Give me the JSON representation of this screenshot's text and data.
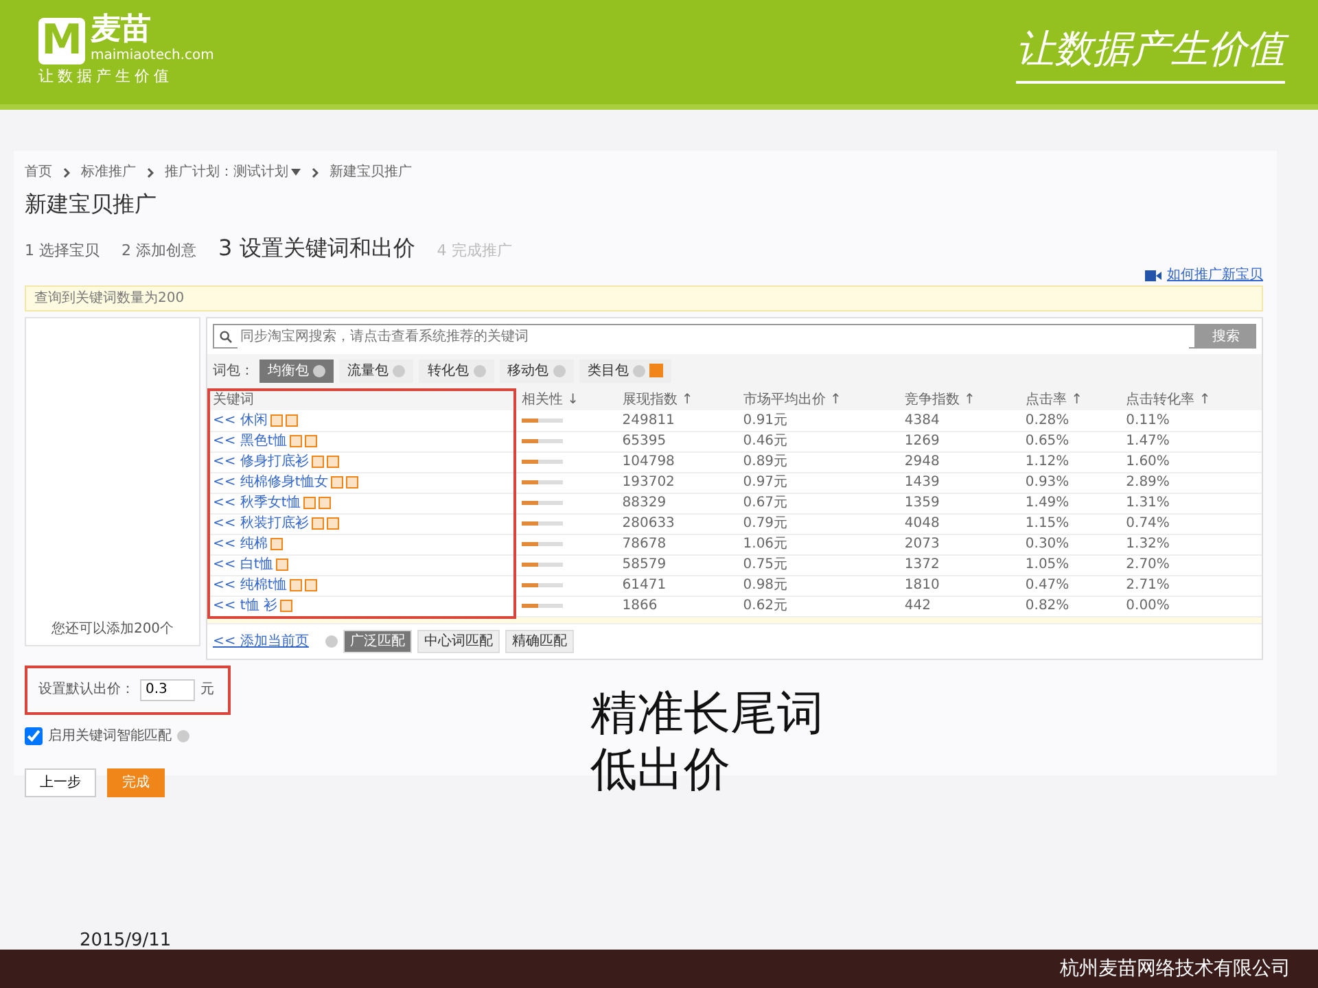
{
  "header": {
    "logo_mark": "M",
    "logo_name": "麦苗",
    "logo_domain": "maimiaotech.com",
    "logo_slogan": "让数据产生价值",
    "slogan": "让数据产生价值"
  },
  "breadcrumb": [
    {
      "label": "首页",
      "dropdown": false
    },
    {
      "label": "标准推广",
      "dropdown": false
    },
    {
      "label": "推广计划：测试计划",
      "dropdown": true
    },
    {
      "label": "新建宝贝推广",
      "dropdown": false
    }
  ],
  "page_title": "新建宝贝推广",
  "steps": [
    {
      "label": "1 选择宝贝",
      "selected": false,
      "disabled": false
    },
    {
      "label": "2 添加创意",
      "selected": false,
      "disabled": false
    },
    {
      "label": "3 设置关键词和出价",
      "selected": true,
      "disabled": false
    },
    {
      "label": "4 完成推广",
      "selected": false,
      "disabled": true
    }
  ],
  "help_link": "如何推广新宝贝",
  "notice": "查询到关键词数量为200",
  "left_panel": {
    "remaining": "您还可以添加200个"
  },
  "search": {
    "placeholder": "同步淘宝网搜索，请点击查看系统推荐的关键词",
    "button": "搜索"
  },
  "packages": {
    "label": "词包：",
    "items": [
      {
        "label": "均衡包",
        "selected": true,
        "badge": false
      },
      {
        "label": "流量包",
        "selected": false,
        "badge": false
      },
      {
        "label": "转化包",
        "selected": false,
        "badge": false
      },
      {
        "label": "移动包",
        "selected": false,
        "badge": false
      },
      {
        "label": "类目包",
        "selected": false,
        "badge": true
      }
    ]
  },
  "table": {
    "columns": [
      "关键词",
      "相关性 ↓",
      "展现指数 ↑",
      "市场平均出价 ↑",
      "竞争指数 ↑",
      "点击率 ↑",
      "点击转化率 ↑"
    ],
    "rows": [
      {
        "extra_tag": true,
        "level": 0.4,
        "cells": [
          "<< 休闲",
          "",
          "249811",
          "0.91元",
          "4384",
          "0.28%",
          "0.11%"
        ]
      },
      {
        "extra_tag": true,
        "level": 0.4,
        "cells": [
          "<< 黑色t恤",
          "",
          "65395",
          "0.46元",
          "1269",
          "0.65%",
          "1.47%"
        ]
      },
      {
        "extra_tag": true,
        "level": 0.4,
        "cells": [
          "<< 修身打底衫",
          "",
          "104798",
          "0.89元",
          "2948",
          "1.12%",
          "1.60%"
        ]
      },
      {
        "extra_tag": true,
        "level": 0.4,
        "cells": [
          "<< 纯棉修身t恤女",
          "",
          "193702",
          "0.97元",
          "1439",
          "0.93%",
          "2.89%"
        ]
      },
      {
        "extra_tag": true,
        "level": 0.4,
        "cells": [
          "<< 秋季女t恤",
          "",
          "88329",
          "0.67元",
          "1359",
          "1.49%",
          "1.31%"
        ]
      },
      {
        "extra_tag": true,
        "level": 0.4,
        "cells": [
          "<< 秋装打底衫",
          "",
          "280633",
          "0.79元",
          "4048",
          "1.15%",
          "0.74%"
        ]
      },
      {
        "extra_tag": false,
        "level": 0.4,
        "cells": [
          "<< 纯棉",
          "",
          "78678",
          "1.06元",
          "2073",
          "0.30%",
          "1.32%"
        ]
      },
      {
        "extra_tag": false,
        "level": 0.4,
        "cells": [
          "<< 白t恤",
          "",
          "58579",
          "0.75元",
          "1372",
          "1.05%",
          "2.70%"
        ]
      },
      {
        "extra_tag": true,
        "level": 0.4,
        "cells": [
          "<< 纯棉t恤",
          "",
          "61471",
          "0.98元",
          "1810",
          "0.47%",
          "2.71%"
        ]
      },
      {
        "extra_tag": false,
        "level": 0.4,
        "cells": [
          "<< t恤 衫",
          "",
          "1866",
          "0.62元",
          "442",
          "0.82%",
          "0.00%"
        ]
      }
    ]
  },
  "add_page": "<< 添加当前页",
  "match_types": [
    {
      "label": "广泛匹配",
      "selected": true
    },
    {
      "label": "中心词匹配",
      "selected": false
    },
    {
      "label": "精确匹配",
      "selected": false
    }
  ],
  "default_bid": {
    "label": "设置默认出价：",
    "value": "0.3",
    "unit": "元"
  },
  "smart_match": {
    "label": "启用关键词智能匹配",
    "checked": true
  },
  "buttons": [
    {
      "label": "上一步",
      "kind": "secondary"
    },
    {
      "label": "完成",
      "kind": "primary"
    }
  ],
  "callout": [
    "精准长尾词",
    "低出价"
  ],
  "date": "2015/9/11",
  "footer": "杭州麦苗网络技术有限公司"
}
